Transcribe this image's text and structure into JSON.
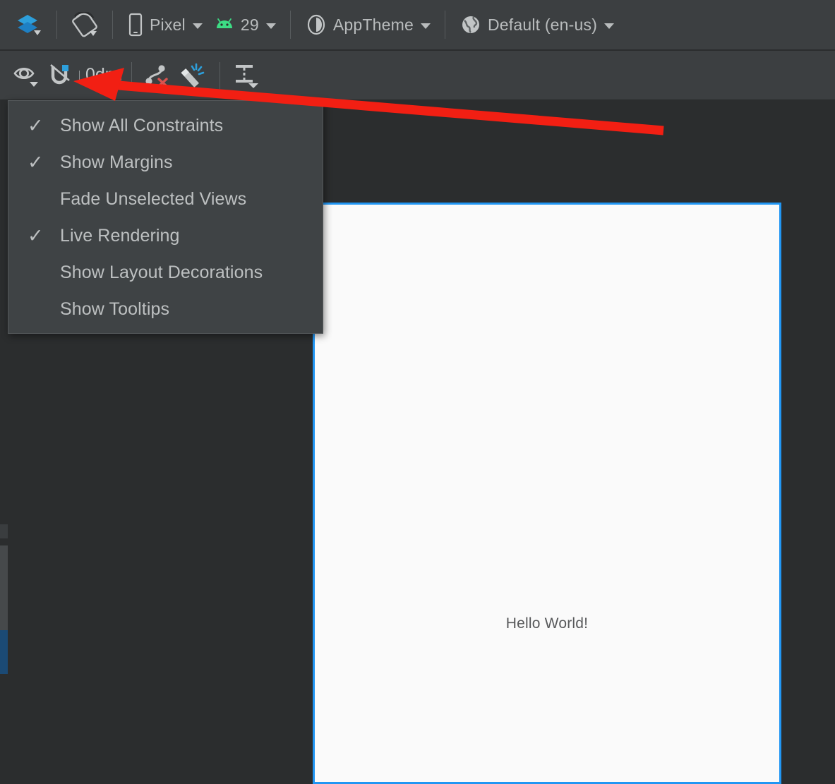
{
  "toolbar_top": {
    "layout_variants_icon": "layers-icon",
    "orientation_icon": "rotate-device-icon",
    "items": [
      {
        "icon": "phone-icon",
        "label": "Pixel",
        "caret": true
      },
      {
        "icon": "android-icon",
        "label": "29",
        "caret": true
      },
      {
        "icon": "theme-contrast-icon",
        "label": "AppTheme",
        "caret": true
      },
      {
        "icon": "globe-icon",
        "label": "Default (en-us)",
        "caret": true
      }
    ]
  },
  "toolbar_constraints": {
    "view_options_icon": "eye-icon",
    "autoconnect_icon": "magnet-icon",
    "default_margin_value": "0dp",
    "clear_constraints_icon": "clear-constraints-icon",
    "infer_constraints_icon": "magic-wand-icon",
    "pack_icon": "pack-align-icon"
  },
  "view_options_menu": {
    "items": [
      {
        "label": "Show All Constraints",
        "checked": true
      },
      {
        "label": "Show Margins",
        "checked": true
      },
      {
        "label": "Fade Unselected Views",
        "checked": false
      },
      {
        "label": "Live Rendering",
        "checked": true
      },
      {
        "label": "Show Layout Decorations",
        "checked": false
      },
      {
        "label": "Show Tooltips",
        "checked": false
      }
    ],
    "check_glyph": "✓"
  },
  "design_surface": {
    "preview": {
      "hello_text": "Hello World!"
    }
  },
  "colors": {
    "toolbar_bg": "#3c3f41",
    "canvas_bg": "#2b2d2e",
    "menu_bg": "#3f4345",
    "selection_blue": "#2196f3",
    "annotation_red": "#f21f13",
    "android_green": "#3ddc84",
    "accent_cyan": "#2d9fdb",
    "device_white": "#fafafa",
    "text_primary": "#bdc0c1"
  }
}
